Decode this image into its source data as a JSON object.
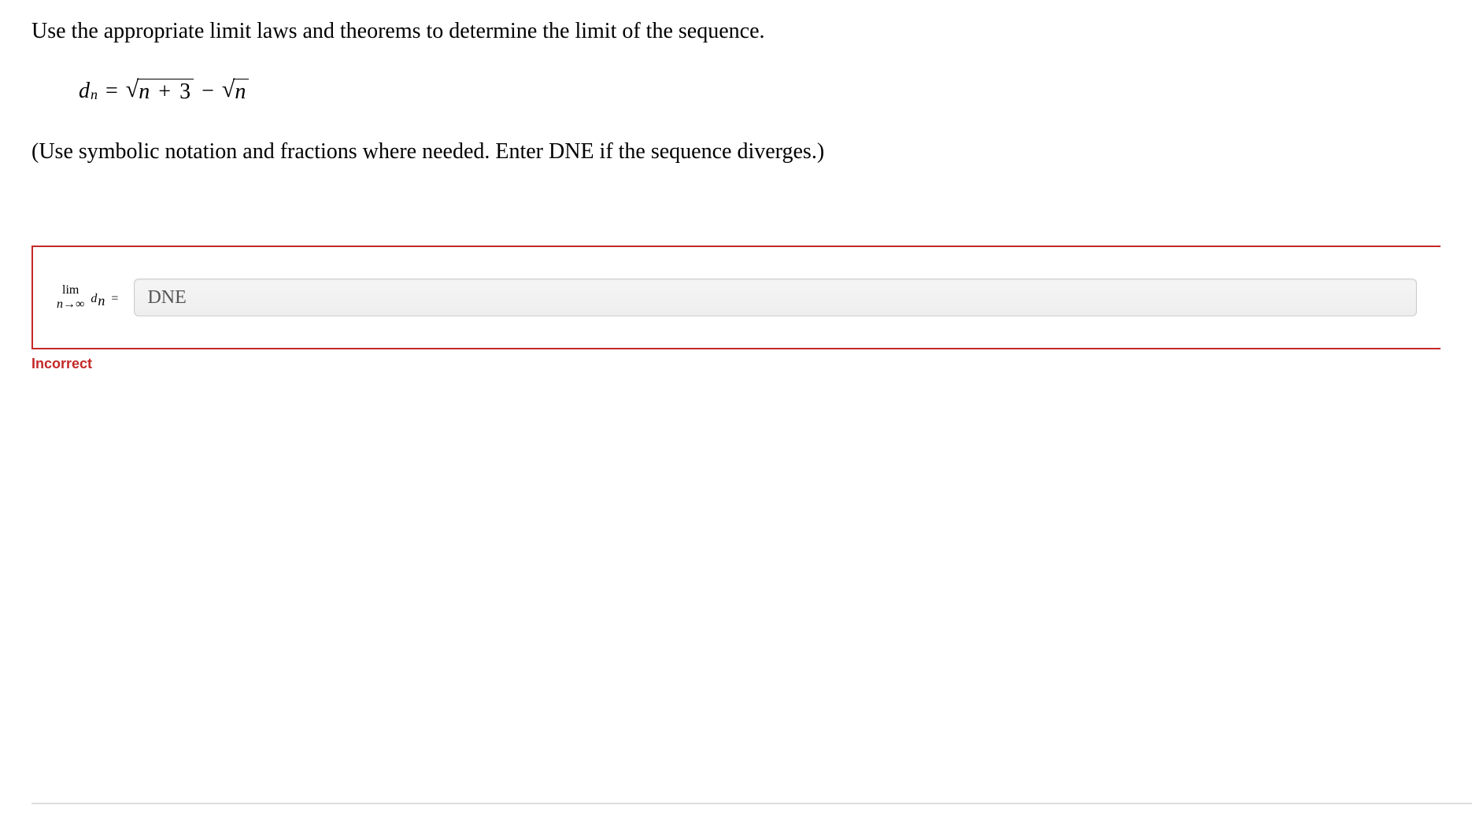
{
  "question": {
    "prompt": "Use the appropriate limit laws and theorems to determine the limit of the sequence.",
    "instruction": "(Use symbolic notation and fractions where needed. Enter DNE if the sequence diverges.)"
  },
  "equation": {
    "variable": "d",
    "subscript": "n",
    "sqrt1_inner_var": "n",
    "sqrt1_inner_const": "3",
    "sqrt2_inner": "n"
  },
  "answer": {
    "limit_label": "lim",
    "limit_sub_var": "n",
    "limit_sub_arrow": "→",
    "limit_sub_infinity": "∞",
    "limit_var": "d",
    "limit_var_sub": "n",
    "equals": "=",
    "input_value": "DNE"
  },
  "feedback": {
    "status": "Incorrect"
  },
  "colors": {
    "error_border": "#c42828",
    "error_text": "#c42828"
  }
}
